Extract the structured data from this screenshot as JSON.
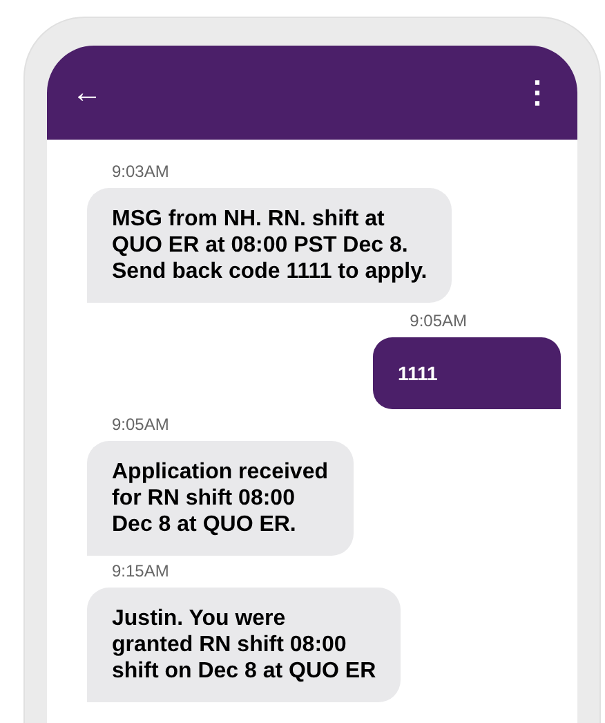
{
  "header": {
    "back": "←",
    "menu": "⋮"
  },
  "messages": [
    {
      "time": "9:03AM",
      "kind": "received",
      "text": "MSG from NH. RN. shift at\nQUO ER at 08:00 PST Dec 8.\nSend back code 1111 to apply."
    },
    {
      "time": "9:05AM",
      "kind": "sent",
      "text": "1111"
    },
    {
      "time": "9:05AM",
      "kind": "received",
      "text": "Application received\nfor RN shift 08:00\nDec 8 at QUO ER."
    },
    {
      "time": "9:15AM",
      "kind": "received",
      "text": "Justin. You were\ngranted RN shift 08:00\nshift on Dec 8 at QUO ER"
    }
  ]
}
